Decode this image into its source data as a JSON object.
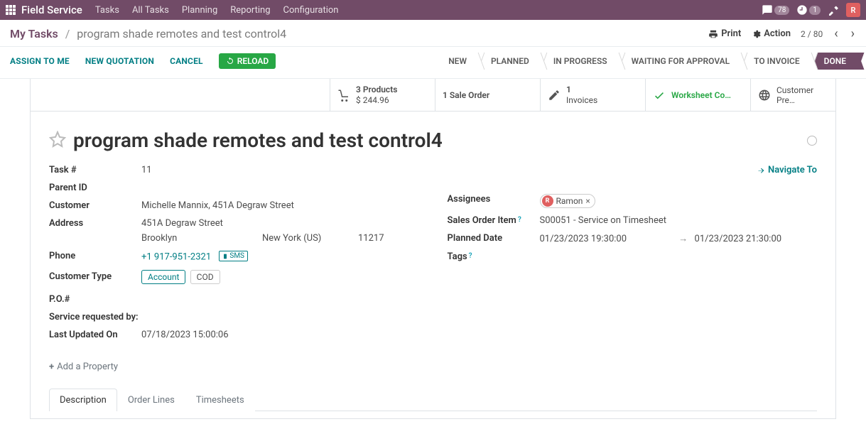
{
  "topbar": {
    "brand": "Field Service",
    "nav": [
      "Tasks",
      "All Tasks",
      "Planning",
      "Reporting",
      "Configuration"
    ],
    "msg_badge": "78",
    "clock_badge": "1",
    "avatar_letter": "R"
  },
  "breadcrumb": {
    "root": "My Tasks",
    "task": "program shade remotes and test control4"
  },
  "head_actions": {
    "print": "Print",
    "action": "Action",
    "pager": "2 / 80"
  },
  "action_bar": {
    "assign": "ASSIGN TO ME",
    "quote": "NEW QUOTATION",
    "cancel": "CANCEL",
    "reload": "RELOAD",
    "stages": [
      "NEW",
      "PLANNED",
      "IN PROGRESS",
      "WAITING FOR APPROVAL",
      "TO INVOICE",
      "DONE"
    ]
  },
  "stats": {
    "products_top": "3 Products",
    "products_sub": "$ 244.96",
    "sale_order": "1 Sale Order",
    "invoices_top": "1",
    "invoices_sub": "Invoices",
    "worksheet": "Worksheet Co…",
    "preview": "Customer Pre…"
  },
  "title": "program shade remotes and test control4",
  "left": {
    "task_num_label": "Task #",
    "task_num": "11",
    "parent_label": "Parent ID",
    "customer_label": "Customer",
    "customer": "Michelle Mannix, 451A  Degraw Street",
    "address_label": "Address",
    "addr_street": "451A Degraw Street",
    "addr_city": "Brooklyn",
    "addr_state": "New York (US)",
    "addr_zip": "11217",
    "phone_label": "Phone",
    "phone": "+1 917-951-2321",
    "sms": "SMS",
    "ctype_label": "Customer Type",
    "ctype_account": "Account",
    "ctype_cod": "COD",
    "po_label": "P.O.#",
    "req_label": "Service requested by:",
    "updated_label": "Last Updated On",
    "updated": "07/18/2023 15:00:06",
    "add_prop": "Add a Property"
  },
  "right": {
    "navigate": "Navigate To",
    "assignees_label": "Assignees",
    "assignee_initial": "R",
    "assignee_name": "Ramon",
    "soi_label": "Sales Order Item",
    "soi": "S00051 - Service on Timesheet",
    "planned_label": "Planned Date",
    "planned_from": "01/23/2023 19:30:00",
    "planned_to": "01/23/2023 21:30:00",
    "tags_label": "Tags"
  },
  "tabs": [
    "Description",
    "Order Lines",
    "Timesheets"
  ]
}
